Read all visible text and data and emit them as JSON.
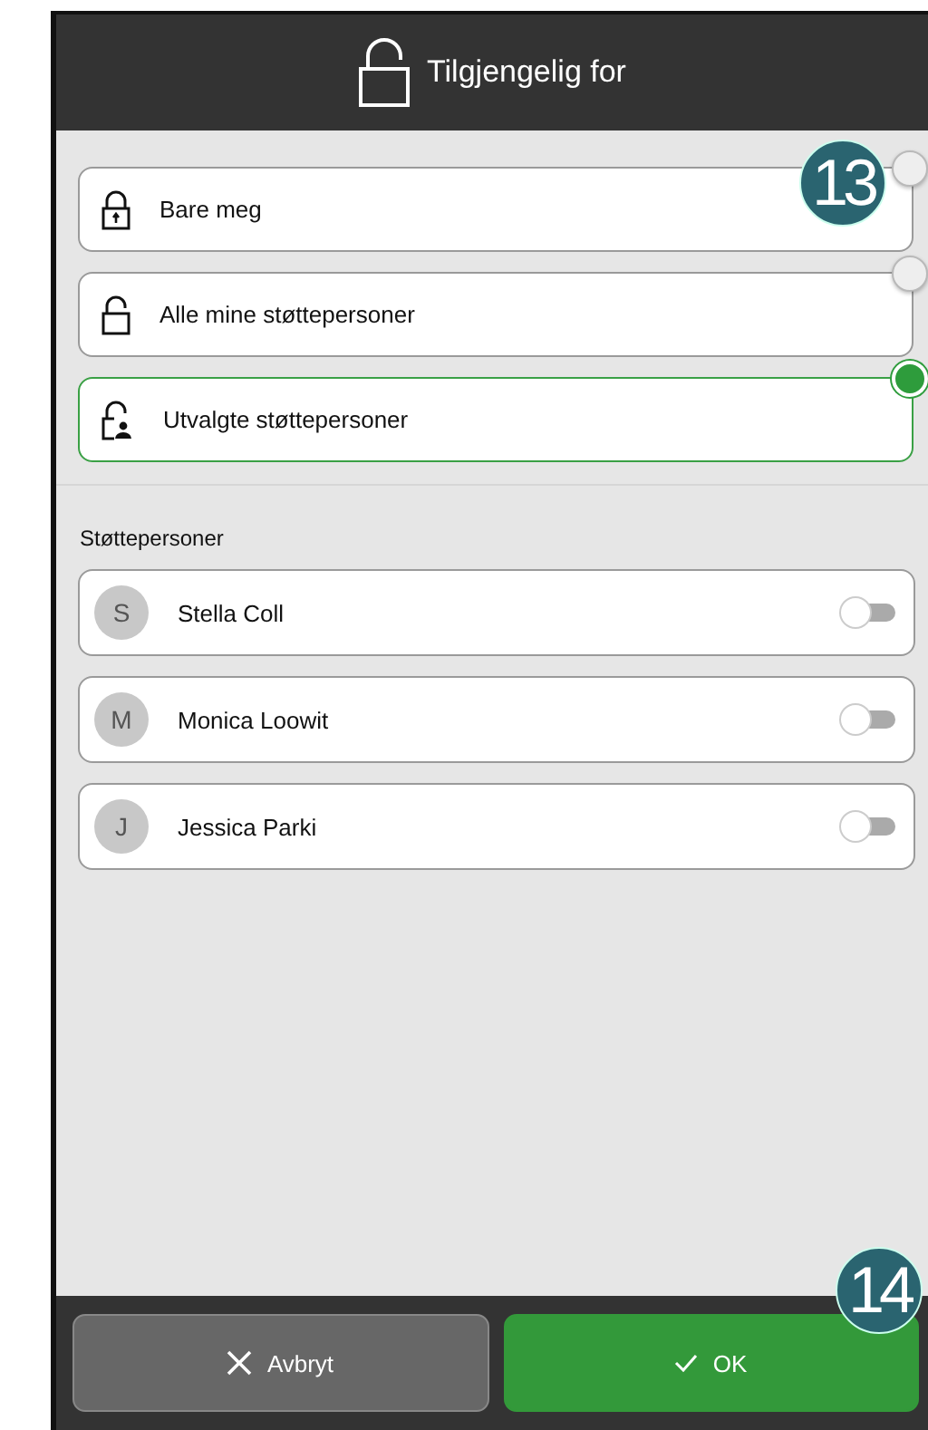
{
  "header": {
    "title": "Tilgjengelig for"
  },
  "options": [
    {
      "label": "Bare meg",
      "kind": "locked",
      "selected": false
    },
    {
      "label": "Alle mine støttepersoner",
      "kind": "unlocked",
      "selected": false
    },
    {
      "label": "Utvalgte støttepersoner",
      "kind": "person",
      "selected": true
    }
  ],
  "section_title": "Støttepersoner",
  "people": [
    {
      "initial": "S",
      "name": "Stella Coll",
      "on": false
    },
    {
      "initial": "M",
      "name": "Monica Loowit",
      "on": false
    },
    {
      "initial": "J",
      "name": "Jessica Parki",
      "on": false
    }
  ],
  "buttons": [
    {
      "label": "Avbryt",
      "kind": "cancel"
    },
    {
      "label": "OK",
      "kind": "confirm"
    }
  ],
  "callouts": [
    {
      "label": "13",
      "kind": "options"
    },
    {
      "label": "14",
      "kind": "footer"
    }
  ]
}
